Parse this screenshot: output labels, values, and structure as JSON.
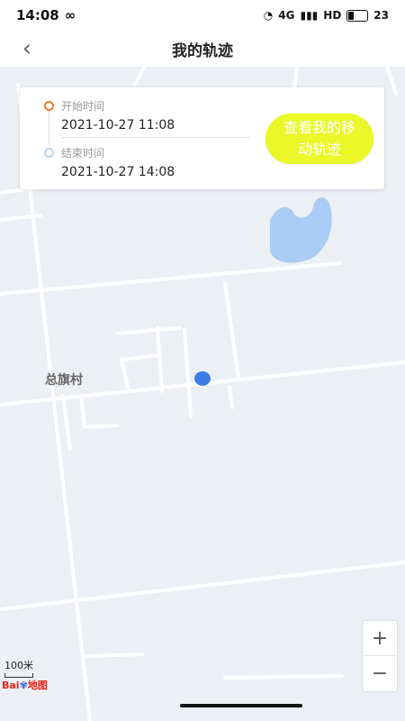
{
  "status_bar": {
    "time": "14:08",
    "link_icon": "infinity-icon",
    "network": "4G",
    "battery_level": "23"
  },
  "header": {
    "title": "我的轨迹",
    "back_icon": "chevron-left-icon"
  },
  "info_card": {
    "start_label": "开始时间",
    "start_value": "2021-10-27 11:08",
    "end_label": "结束时间",
    "end_value": "2021-10-27 14:08",
    "track_button_label": "查看我的移动轨迹"
  },
  "map": {
    "place_label": "总旗村",
    "scale_label": "100米",
    "logo_text": "Bai",
    "logo_suffix": "地图",
    "zoom_in_label": "+",
    "zoom_out_label": "−"
  },
  "colors": {
    "accent_button": "#eaf82a",
    "start_dot": "#f07c2a",
    "end_dot": "#b7d7ef",
    "marker": "#3b7de6",
    "water": "#a9cdf4"
  }
}
